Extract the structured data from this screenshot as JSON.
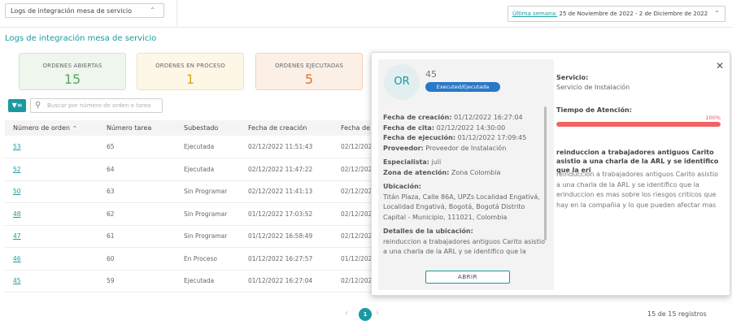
{
  "topbar": {
    "module_select": "Logs de integración mesa de servicio",
    "week_label": "Última semana:",
    "week_range": "25 de Noviembre de 2022 - 2 de Diciembre de 2022"
  },
  "page_title": "Logs de integración mesa de servicio",
  "cards": {
    "open": {
      "label": "ORDENES ABIERTAS",
      "value": "15"
    },
    "in_process": {
      "label": "ORDENES EN PROCESO",
      "value": "1"
    },
    "executed": {
      "label": "ORDENES EJECUTADAS",
      "value": "5"
    }
  },
  "search": {
    "placeholder": "Buscar por número de orden o tarea"
  },
  "table": {
    "headers": [
      "Número de orden",
      "Número tarea",
      "Subestado",
      "Fecha de creación",
      "Fecha de c"
    ],
    "rows": [
      [
        "53",
        "65",
        "Ejecutada",
        "02/12/2022 11:51:43",
        "02/12/202"
      ],
      [
        "52",
        "64",
        "Ejecutada",
        "02/12/2022 11:47:22",
        "02/12/202"
      ],
      [
        "50",
        "63",
        "Sin Programar",
        "02/12/2022 11:41:13",
        "02/12/202"
      ],
      [
        "48",
        "62",
        "Sin Programar",
        "01/12/2022 17:03:52",
        "02/12/202"
      ],
      [
        "47",
        "61",
        "Sin Programar",
        "01/12/2022 16:58:49",
        "02/12/202"
      ],
      [
        "46",
        "60",
        "En Proceso",
        "01/12/2022 16:27:57",
        "01/12/202"
      ],
      [
        "45",
        "59",
        "Ejecutada",
        "01/12/2022 16:27:04",
        "02/12/202"
      ]
    ]
  },
  "pagination": {
    "current": "1",
    "records": "15 de 15 registros"
  },
  "popover": {
    "avatar": "OR",
    "order_number": "45",
    "status": "Executed/Ejecutada",
    "details": {
      "creation_label": "Fecha de creación:",
      "creation_value": "01/12/2022 16:27:04",
      "appointment_label": "Fecha de cita:",
      "appointment_value": "02/12/2022 14:30:00",
      "execution_label": "Fecha de ejecución:",
      "execution_value": "01/12/2022 17:09:45",
      "provider_label": "Proveedor:",
      "provider_value": "Proveedor de Instalación",
      "specialist_label": "Especialista:",
      "specialist_value": "juli",
      "zone_label": "Zona de atención:",
      "zone_value": "Zona Colombia",
      "location_label": "Ubicación:",
      "location_value": "Titán Plaza, Calle 86A, UPZs Localidad Engativá, Localidad Engativá, Bogotá, Bogotá Distrito Capital - Municipio, 111021, Colombia",
      "location_details_label": "Detalles de la ubicación:",
      "location_details_value": "reinduccion a trabajadores antiguos Carito asistio a una charla de la ARL y se identifico que la"
    },
    "open_button": "ABRIR",
    "service_label": "Servicio:",
    "service_value": "Servicio de Instalación",
    "attention_label": "Tiempo de Atención:",
    "progress": {
      "percent": 100,
      "label": "100%"
    },
    "description_title": "reinduccion a trabajadores antiguos Carito asistio a una charla de la ARL y se identifico que la eri",
    "description_text": "reinduccion a trabajadores antiguos Carito asistio a una charla de la ARL y se identifico que la erinduccion es mas sobre los riesgos criticos que hay en la compañia y lo que pueden afectar mas"
  },
  "colors": {
    "accent": "#1a9aa0",
    "badge": "#2a78c8",
    "progress": "#f06464"
  }
}
